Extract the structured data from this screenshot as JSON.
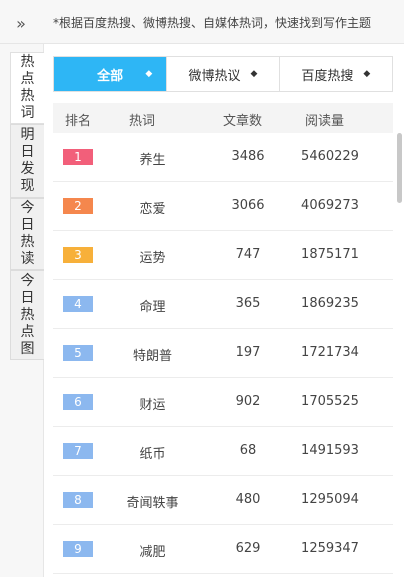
{
  "header": {
    "collapse_icon": "double-chevron-right-icon",
    "collapse_glyph": "»",
    "tip": "*根据百度热搜、微博热搜、自媒体热词，快速找到写作主题"
  },
  "sidebar": {
    "tabs": [
      {
        "chars": [
          "热",
          "点",
          "热",
          "词"
        ],
        "active": true
      },
      {
        "chars": [
          "明",
          "日",
          "发",
          "现"
        ],
        "active": false
      },
      {
        "chars": [
          "今",
          "日",
          "热",
          "读"
        ],
        "active": false
      },
      {
        "chars": [
          "今",
          "日",
          "热",
          "点",
          "图"
        ],
        "active": false
      }
    ]
  },
  "filters": [
    {
      "label": "全部",
      "active": true,
      "caret": "◆"
    },
    {
      "label": "微博热议",
      "active": false,
      "caret": "◆"
    },
    {
      "label": "百度热搜",
      "active": false,
      "caret": "◆"
    }
  ],
  "table": {
    "headers": {
      "rank": "排名",
      "word": "热词",
      "articles": "文章数",
      "reads": "阅读量"
    },
    "rows": [
      {
        "rank": "1",
        "word": "养生",
        "articles": "3486",
        "reads": "5460229",
        "color": "#f25f7a"
      },
      {
        "rank": "2",
        "word": "恋爱",
        "articles": "3066",
        "reads": "4069273",
        "color": "#f5874d"
      },
      {
        "rank": "3",
        "word": "运势",
        "articles": "747",
        "reads": "1875171",
        "color": "#f7b03a"
      },
      {
        "rank": "4",
        "word": "命理",
        "articles": "365",
        "reads": "1869235",
        "color": "#8cb8ef"
      },
      {
        "rank": "5",
        "word": "特朗普",
        "articles": "197",
        "reads": "1721734",
        "color": "#8cb8ef"
      },
      {
        "rank": "6",
        "word": "财运",
        "articles": "902",
        "reads": "1705525",
        "color": "#8cb8ef"
      },
      {
        "rank": "7",
        "word": "纸币",
        "articles": "68",
        "reads": "1491593",
        "color": "#8cb8ef"
      },
      {
        "rank": "8",
        "word": "奇闻轶事",
        "articles": "480",
        "reads": "1295094",
        "color": "#8cb8ef"
      },
      {
        "rank": "9",
        "word": "减肥",
        "articles": "629",
        "reads": "1259347",
        "color": "#8cb8ef"
      }
    ]
  },
  "colors": {
    "accent": "#2eb6f5"
  }
}
